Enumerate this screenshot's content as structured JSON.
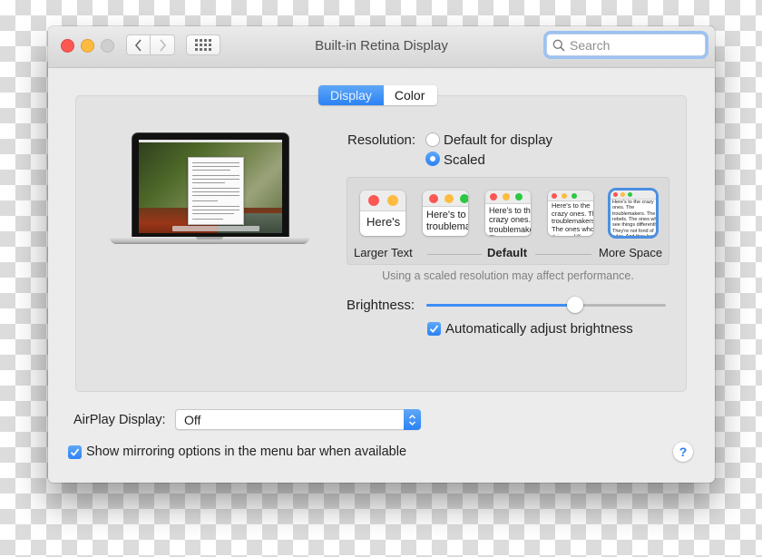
{
  "window": {
    "title": "Built-in Retina Display",
    "search": {
      "placeholder": "Search",
      "value": ""
    },
    "traffic_lights": {
      "close": "#fc5753",
      "minimize": "#fdbc40",
      "zoom": "#cfcfcf"
    },
    "nav": {
      "back_icon": "chevron-left-icon",
      "forward_icon": "chevron-right-icon",
      "show_all_icon": "grid-icon"
    }
  },
  "tabs": [
    {
      "label": "Display",
      "active": true
    },
    {
      "label": "Color",
      "active": false
    }
  ],
  "resolution": {
    "label": "Resolution:",
    "options": [
      {
        "label": "Default for display",
        "selected": false
      },
      {
        "label": "Scaled",
        "selected": true
      }
    ]
  },
  "scaling": {
    "thumbnails": [
      {
        "text": "Here's",
        "selected": false
      },
      {
        "text": "Here's to the troublemakers.",
        "selected": false
      },
      {
        "text": "Here's to the crazy ones. The troublemakers. The ones who see",
        "selected": false
      },
      {
        "text": "Here's to the crazy ones. The troublemakers. The ones who see things differently. rules. And they",
        "selected": false
      },
      {
        "text": "Here's to the crazy ones. The troublemakers. The rebels. The ones who see things differently. They're not fond of rules. And they have no respect. You can quote them, disagree with them. About the only thing you can't do is ignore them. Because they change things.",
        "selected": true
      }
    ],
    "labels": {
      "left": "Larger Text",
      "middle": "Default",
      "right": "More Space"
    },
    "note": "Using a scaled resolution may affect performance."
  },
  "brightness": {
    "label": "Brightness:",
    "value_fraction": 0.62,
    "auto_adjust": {
      "label": "Automatically adjust brightness",
      "checked": true
    }
  },
  "airplay": {
    "label": "AirPlay Display:",
    "selected": "Off"
  },
  "mirroring": {
    "label": "Show mirroring options in the menu bar when available",
    "checked": true
  },
  "help": {
    "label": "?"
  },
  "colors": {
    "accent": "#2b82f4",
    "panel": "#e3e3e3",
    "window": "#ececec"
  }
}
